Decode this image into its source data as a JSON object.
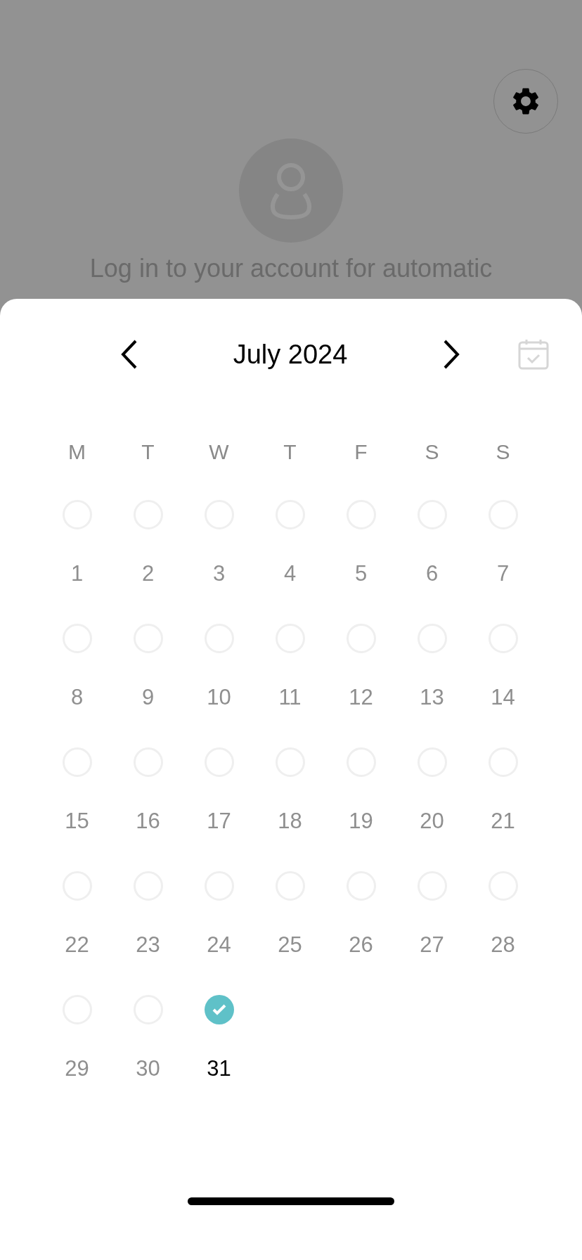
{
  "background": {
    "message": "Log in to your account for automatic"
  },
  "calendar": {
    "month": "July 2024",
    "weekdays": [
      "M",
      "T",
      "W",
      "T",
      "F",
      "S",
      "S"
    ],
    "weeks": [
      [
        {
          "day": "1",
          "checked": false
        },
        {
          "day": "2",
          "checked": false
        },
        {
          "day": "3",
          "checked": false
        },
        {
          "day": "4",
          "checked": false
        },
        {
          "day": "5",
          "checked": false
        },
        {
          "day": "6",
          "checked": false
        },
        {
          "day": "7",
          "checked": false
        }
      ],
      [
        {
          "day": "8",
          "checked": false
        },
        {
          "day": "9",
          "checked": false
        },
        {
          "day": "10",
          "checked": false
        },
        {
          "day": "11",
          "checked": false
        },
        {
          "day": "12",
          "checked": false
        },
        {
          "day": "13",
          "checked": false
        },
        {
          "day": "14",
          "checked": false
        }
      ],
      [
        {
          "day": "15",
          "checked": false
        },
        {
          "day": "16",
          "checked": false
        },
        {
          "day": "17",
          "checked": false
        },
        {
          "day": "18",
          "checked": false
        },
        {
          "day": "19",
          "checked": false
        },
        {
          "day": "20",
          "checked": false
        },
        {
          "day": "21",
          "checked": false
        }
      ],
      [
        {
          "day": "22",
          "checked": false
        },
        {
          "day": "23",
          "checked": false
        },
        {
          "day": "24",
          "checked": false
        },
        {
          "day": "25",
          "checked": false
        },
        {
          "day": "26",
          "checked": false
        },
        {
          "day": "27",
          "checked": false
        },
        {
          "day": "28",
          "checked": false
        }
      ],
      [
        {
          "day": "29",
          "checked": false
        },
        {
          "day": "30",
          "checked": false
        },
        {
          "day": "31",
          "checked": true
        }
      ]
    ]
  }
}
